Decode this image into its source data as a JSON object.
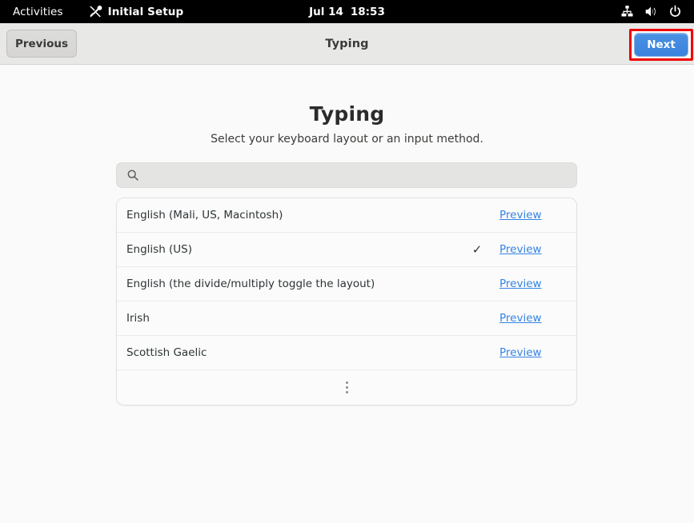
{
  "topbar": {
    "activities": "Activities",
    "app_name": "Initial Setup",
    "app_icon": "tools-icon",
    "clock_date": "Jul 14",
    "clock_time": "18:53",
    "status_icons": [
      "network-wired-icon",
      "volume-icon",
      "power-icon"
    ]
  },
  "headerbar": {
    "previous_label": "Previous",
    "title": "Typing",
    "next_label": "Next",
    "next_highlight_color": "#f00000",
    "next_accent_color": "#3a83dd"
  },
  "page": {
    "title": "Typing",
    "subtitle": "Select your keyboard layout or an input method."
  },
  "search": {
    "icon": "search-icon",
    "value": "",
    "placeholder": ""
  },
  "list": {
    "preview_label": "Preview",
    "check_glyph": "✓",
    "more_icon": "view-more-vertical-icon",
    "items": [
      {
        "label": "English (Mali, US, Macintosh)",
        "selected": false
      },
      {
        "label": "English (US)",
        "selected": true
      },
      {
        "label": "English (the divide/multiply toggle the layout)",
        "selected": false
      },
      {
        "label": "Irish",
        "selected": false
      },
      {
        "label": "Scottish Gaelic",
        "selected": false
      }
    ]
  }
}
